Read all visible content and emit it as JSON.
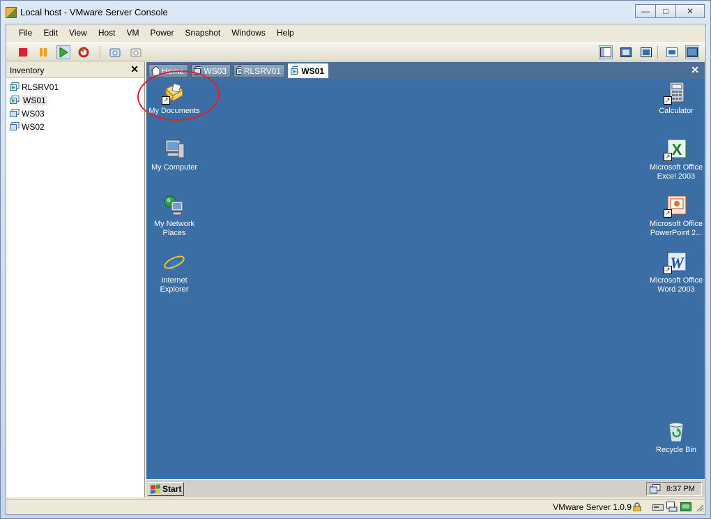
{
  "window": {
    "title": "Local host - VMware Server Console"
  },
  "menu": [
    "File",
    "Edit",
    "View",
    "Host",
    "VM",
    "Power",
    "Snapshot",
    "Windows",
    "Help"
  ],
  "inventory": {
    "title": "Inventory",
    "items": [
      {
        "label": "RLSRV01",
        "running": true
      },
      {
        "label": "WS01",
        "running": true,
        "selected": true
      },
      {
        "label": "WS03",
        "running": false
      },
      {
        "label": "WS02",
        "running": false
      }
    ]
  },
  "tabs": [
    {
      "label": "Home",
      "icon": "home-icon"
    },
    {
      "label": "WS03",
      "icon": "vm-icon"
    },
    {
      "label": "RLSRV01",
      "icon": "vm-running-icon"
    },
    {
      "label": "WS01",
      "icon": "vm-running-icon",
      "active": true
    }
  ],
  "desktop": {
    "left_icons": [
      {
        "label": "My Documents",
        "icon": "my-documents-icon"
      },
      {
        "label": "My Computer",
        "icon": "my-computer-icon"
      },
      {
        "label": "My Network Places",
        "icon": "network-places-icon"
      },
      {
        "label": "Internet Explorer",
        "icon": "internet-explorer-icon"
      }
    ],
    "right_icons": [
      {
        "label": "Calculator",
        "icon": "calculator-icon"
      },
      {
        "label": "Microsoft Office Excel 2003",
        "icon": "excel-icon"
      },
      {
        "label": "Microsoft Office PowerPoint 2...",
        "icon": "powerpoint-icon"
      },
      {
        "label": "Microsoft Office Word 2003",
        "icon": "word-icon"
      },
      {
        "label": "Recycle Bin",
        "icon": "recycle-bin-icon"
      }
    ],
    "background": "#3a6ea5"
  },
  "taskbar": {
    "start_label": "Start",
    "clock": "8:37 PM"
  },
  "status": {
    "text": "VMware Server 1.0.9"
  }
}
